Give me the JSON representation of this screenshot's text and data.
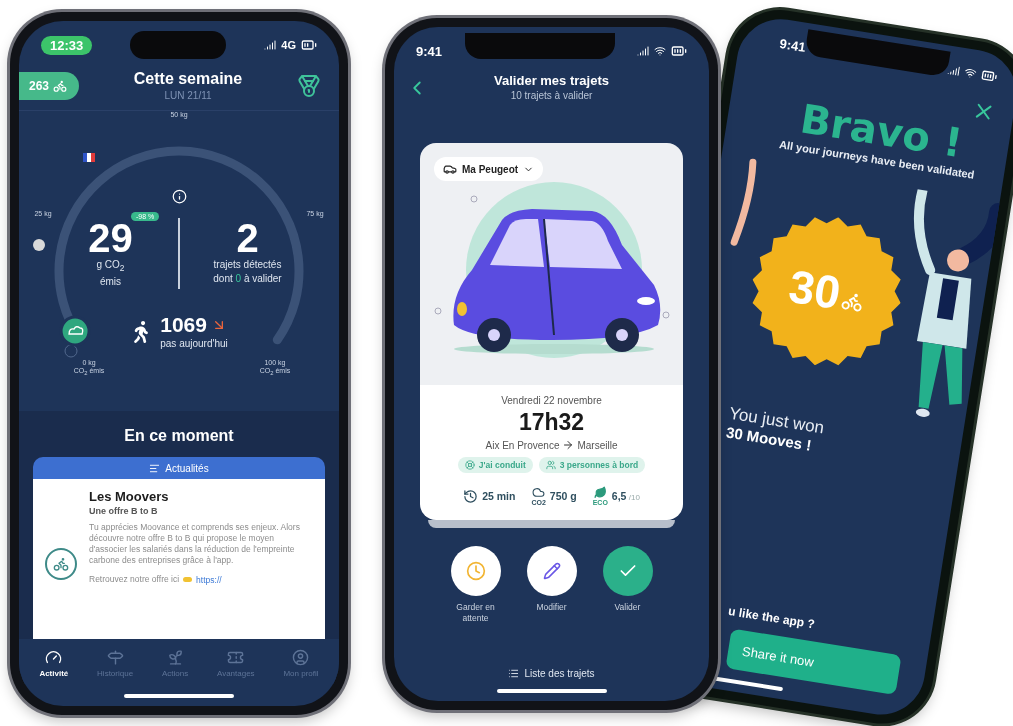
{
  "activity_screen": {
    "status_time": "12:33",
    "network": "4G",
    "mooves_badge": "263",
    "title": "Cette semaine",
    "subtitle": "LUN 21/11",
    "gauge": {
      "level": 0.02,
      "top_label": "50 kg",
      "left_label": "25 kg",
      "right_label": "75 kg",
      "start_label": "0 kg",
      "start_caption": "CO$_{2}$ émis",
      "end_label": "100 kg",
      "end_caption": "CO$_{2}$ émis"
    },
    "emissions": {
      "value": "29",
      "change": "-98 %",
      "unit": "g CO$_{2}$",
      "caption": "émis"
    },
    "trips": {
      "value": "2",
      "caption": "trajets détectés",
      "pending": "dont **0** à valider"
    },
    "steps": {
      "value": "1069",
      "caption": "pas aujourd'hui"
    },
    "section_title": "En ce moment",
    "news": {
      "header": "Actualités",
      "title": "Les Moovers",
      "subtitle": "Une offre B to B",
      "body": "Tu apprécies Moovance et comprends ses enjeux. Alors découvre notre offre B to B qui propose le moyen d'associer les salariés dans la réduction de l'empreinte carbone des entreprises grâce à l'app.",
      "link_prefix": "Retrouvez notre offre ici",
      "link": "https://"
    },
    "tabs": [
      {
        "kind": "activity",
        "label": "Activité",
        "selected": true
      },
      {
        "kind": "history",
        "label": "Historique",
        "selected": false
      },
      {
        "kind": "actions",
        "label": "Actions",
        "selected": false
      },
      {
        "kind": "perks",
        "label": "Avantages",
        "selected": false
      },
      {
        "kind": "profile",
        "label": "Mon profil",
        "selected": false
      }
    ]
  },
  "trip_screen": {
    "status_time": "9:41",
    "title": "Valider mes trajets",
    "subtitle": "10 trajets à valider",
    "vehicle": "Ma Peugeot",
    "date": "Vendredi 22 novembre",
    "time": "17h32",
    "from": "Aix En Provence",
    "to": "Marseille",
    "tags": [
      {
        "kind": "driver",
        "label": "J'ai conduit"
      },
      {
        "kind": "passengers",
        "label": "3 personnes à bord"
      }
    ],
    "stats": [
      {
        "kind": "duration",
        "value": "25 min"
      },
      {
        "kind": "co2",
        "icon_label": "CO2",
        "value": "750 g"
      },
      {
        "kind": "eco",
        "icon_label": "ECO",
        "value": "6,5",
        "suffix": "/10"
      }
    ],
    "actions": [
      {
        "kind": "wait",
        "label": "Garder en attente"
      },
      {
        "kind": "edit",
        "label": "Modifier"
      },
      {
        "kind": "validate",
        "label": "Valider"
      }
    ],
    "list_link": "Liste des trajets"
  },
  "reward_screen": {
    "status_time": "9:41",
    "title": "Bravo !",
    "subtitle": "All your journeys have been validated",
    "reward": "30",
    "won_line": "You just won",
    "won_amount": "30 Mooves !",
    "question": "u like the app ?",
    "share": "Share it now"
  }
}
